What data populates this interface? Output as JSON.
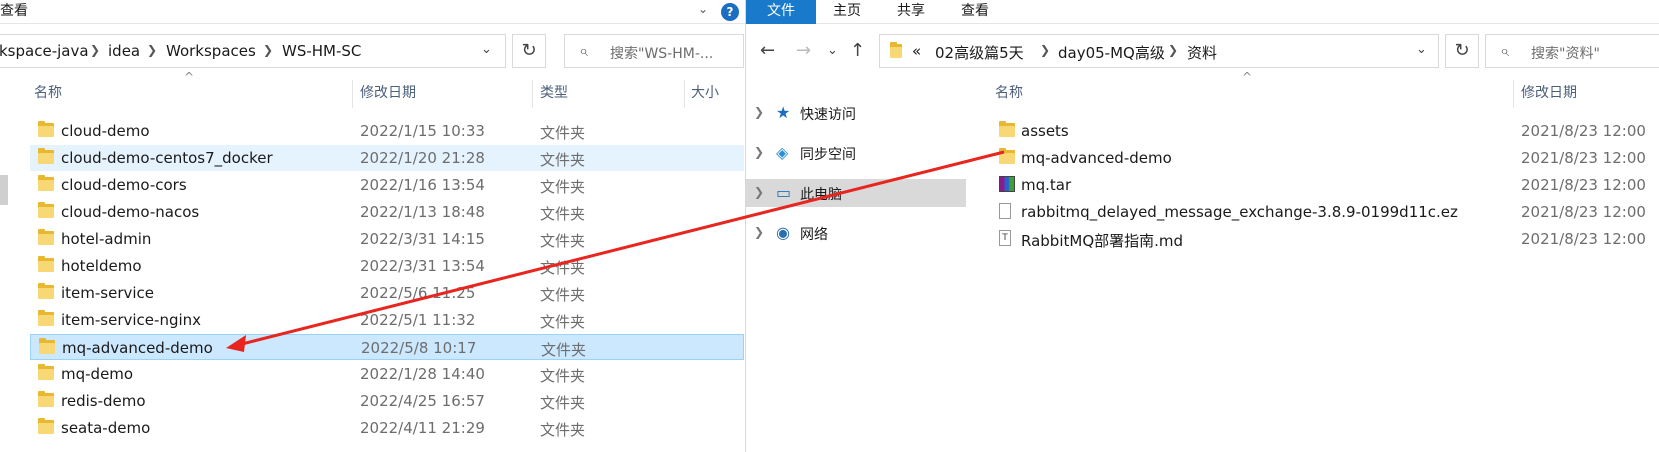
{
  "left": {
    "ribbon_tab": "查看",
    "help_label": "?",
    "breadcrumb": [
      "kspace-java",
      "idea",
      "Workspaces",
      "WS-HM-SC"
    ],
    "search_placeholder": "搜索\"WS-HM-...",
    "columns": {
      "name": "名称",
      "date": "修改日期",
      "type": "类型",
      "size": "大小"
    },
    "rows": [
      {
        "name": "cloud-demo",
        "date": "2022/1/15 10:33",
        "type": "文件夹"
      },
      {
        "name": "cloud-demo-centos7_docker",
        "date": "2022/1/20 21:28",
        "type": "文件夹"
      },
      {
        "name": "cloud-demo-cors",
        "date": "2022/1/16 13:54",
        "type": "文件夹"
      },
      {
        "name": "cloud-demo-nacos",
        "date": "2022/1/13 18:48",
        "type": "文件夹"
      },
      {
        "name": "hotel-admin",
        "date": "2022/3/31 14:15",
        "type": "文件夹"
      },
      {
        "name": "hoteldemo",
        "date": "2022/3/31 13:54",
        "type": "文件夹"
      },
      {
        "name": "item-service",
        "date": "2022/5/6 11:25",
        "type": "文件夹"
      },
      {
        "name": "item-service-nginx",
        "date": "2022/5/1 11:32",
        "type": "文件夹"
      },
      {
        "name": "mq-advanced-demo",
        "date": "2022/5/8 10:17",
        "type": "文件夹"
      },
      {
        "name": "mq-demo",
        "date": "2022/1/28 14:40",
        "type": "文件夹"
      },
      {
        "name": "redis-demo",
        "date": "2022/4/25 16:57",
        "type": "文件夹"
      },
      {
        "name": "seata-demo",
        "date": "2022/4/11 21:29",
        "type": "文件夹"
      }
    ]
  },
  "right": {
    "ribbon_tabs": [
      "文件",
      "主页",
      "共享",
      "查看"
    ],
    "breadcrumb_prefix": "«",
    "breadcrumb": [
      "02高级篇5天",
      "day05-MQ高级",
      "资料"
    ],
    "search_placeholder": "搜索\"资料\"",
    "columns": {
      "name": "名称",
      "date": "修改日期"
    },
    "tree": [
      {
        "label": "快速访问",
        "icon": "star-icon"
      },
      {
        "label": "同步空间",
        "icon": "cloud-sync-icon"
      },
      {
        "label": "此电脑",
        "icon": "computer-icon"
      },
      {
        "label": "网络",
        "icon": "network-icon"
      }
    ],
    "rows": [
      {
        "name": "assets",
        "date": "2021/8/23 12:00",
        "icon": "folder"
      },
      {
        "name": "mq-advanced-demo",
        "date": "2021/8/23 12:00",
        "icon": "folder"
      },
      {
        "name": "mq.tar",
        "date": "2021/8/23 12:00",
        "icon": "archive"
      },
      {
        "name": "rabbitmq_delayed_message_exchange-3.8.9-0199d11c.ez",
        "date": "2021/8/23 12:00",
        "icon": "file"
      },
      {
        "name": "RabbitMQ部署指南.md",
        "date": "2021/8/23 12:00",
        "icon": "text-file"
      }
    ]
  },
  "annotation": {
    "arrow_color": "#e8251f"
  }
}
